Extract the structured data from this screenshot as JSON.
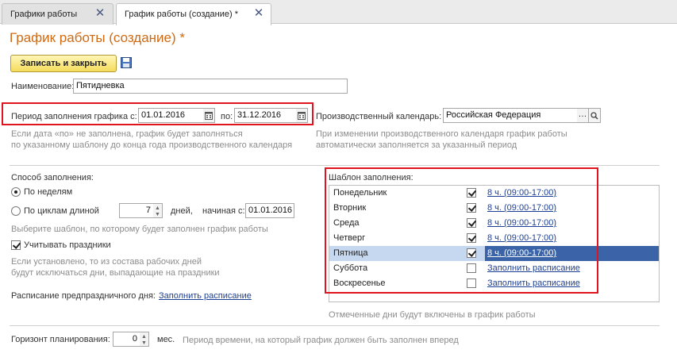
{
  "tabs": [
    {
      "label": "Графики работы"
    },
    {
      "label": "График работы (создание) *"
    }
  ],
  "page_title": "График работы (создание) *",
  "toolbar": {
    "save_close_label": "Записать и закрыть"
  },
  "name_field": {
    "label": "Наименование:",
    "value": "Пятидневка"
  },
  "period": {
    "label_from": "Период заполнения графика с:",
    "date_from": "01.01.2016",
    "label_to": "по:",
    "date_to": "31.12.2016",
    "hint_line1": "Если дата «по» не заполнена, график будет заполняться",
    "hint_line2": "по указанному шаблону до конца года производственного календаря"
  },
  "calendar": {
    "label": "Производственный календарь:",
    "value": "Российская Федерация",
    "hint_line1": "При изменении производственного календаря график работы",
    "hint_line2": "автоматически заполняется за указанный период"
  },
  "fill_method": {
    "label": "Способ заполнения:",
    "option_weeks": "По неделям",
    "option_cycles": "По циклам длиной",
    "cycle_length": "7",
    "days_label": "дней,",
    "start_label": "начиная с:",
    "start_date": "01.01.2016",
    "hint": "Выберите шаблон, по которому будет заполнен график работы"
  },
  "holidays": {
    "label": "Учитывать праздники",
    "hint_line1": "Если установлено, то из состава рабочих дней",
    "hint_line2": "будут исключаться дни, выпадающие на праздники"
  },
  "preholiday": {
    "label": "Расписание предпраздничного дня:",
    "link": "Заполнить расписание"
  },
  "template": {
    "label": "Шаблон заполнения:",
    "rows": [
      {
        "day": "Понедельник",
        "schedule": "8 ч. (09:00-17:00)"
      },
      {
        "day": "Вторник",
        "schedule": "8 ч. (09:00-17:00)"
      },
      {
        "day": "Среда",
        "schedule": "8 ч. (09:00-17:00)"
      },
      {
        "day": "Четверг",
        "schedule": "8 ч. (09:00-17:00)"
      },
      {
        "day": "Пятница",
        "schedule": "8 ч. (09:00-17:00)"
      },
      {
        "day": "Суббота",
        "schedule": "Заполнить расписание"
      },
      {
        "day": "Воскресенье",
        "schedule": "Заполнить расписание"
      }
    ],
    "hint": "Отмеченные дни будут включены в график работы"
  },
  "horizon": {
    "label": "Горизонт планирования:",
    "value": "0",
    "unit": "мес.",
    "hint": "Период времени, на который график должен быть заполнен вперед"
  },
  "colors": {
    "title": "#cf6a12",
    "link": "#1c3f95",
    "highlight": "#e0141e",
    "selected_row": "#c5d8f0"
  }
}
